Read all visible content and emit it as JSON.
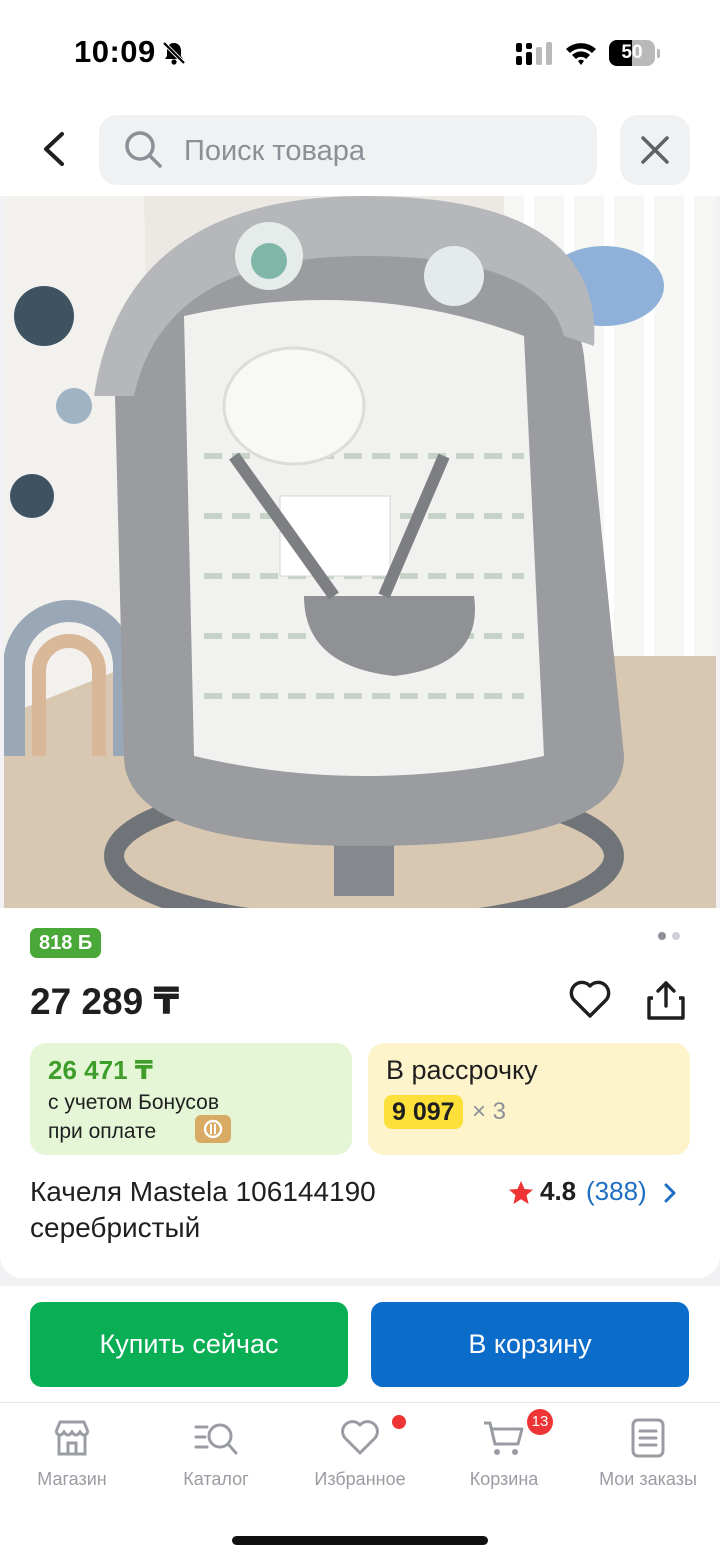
{
  "status_bar": {
    "time": "10:09",
    "battery": "50",
    "battery_level": 0.5,
    "icons": [
      "bell-slash-icon",
      "signal-icon",
      "wifi-icon",
      "battery-icon"
    ]
  },
  "header": {
    "search_placeholder": "Поиск товара",
    "icons": [
      "chevron-left-icon",
      "search-icon",
      "close-icon"
    ]
  },
  "gallery": {
    "image": "product-photo",
    "slide_count": 2,
    "active_slide": 1
  },
  "product": {
    "bonus_badge": "818 Б",
    "price": "27 289 ₸",
    "bonus_offer": {
      "amount": "26 471 ₸",
      "line1": "с учетом Бонусов",
      "line2": "при оплате"
    },
    "installment": {
      "title": "В рассрочку",
      "payment": "9 097",
      "multiplier": "× 3"
    },
    "title_line1": "Качеля Mastela 106144190",
    "title_line2": "серебристый",
    "rating": {
      "score": "4.8",
      "count": "(388)"
    }
  },
  "actions": {
    "buy_now": "Купить сейчас",
    "add_to_cart": "В корзину"
  },
  "tabbar": {
    "items": [
      {
        "label": "Магазин",
        "icon": "store-icon"
      },
      {
        "label": "Каталог",
        "icon": "catalog-search-icon"
      },
      {
        "label": "Избранное",
        "icon": "heart-icon"
      },
      {
        "label": "Корзина",
        "icon": "cart-icon",
        "badge": "13"
      },
      {
        "label": "Мои заказы",
        "icon": "orders-icon"
      }
    ]
  },
  "colors": {
    "buy_green": "#0aae55",
    "cart_blue": "#0c6cc9",
    "bonus_green": "#49a838",
    "installment_yellow": "#fde13a",
    "badge_red": "#ee3434"
  }
}
